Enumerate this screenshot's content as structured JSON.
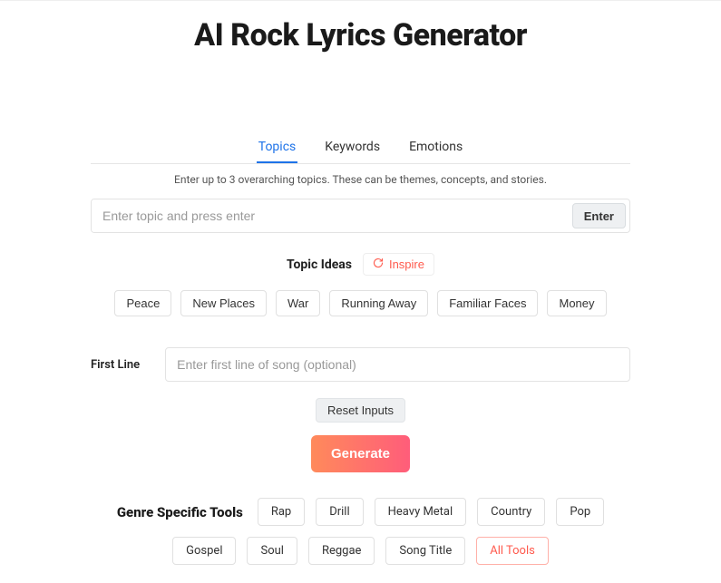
{
  "title": "AI Rock Lyrics Generator",
  "tabs": {
    "items": [
      "Topics",
      "Keywords",
      "Emotions"
    ],
    "active_index": 0
  },
  "hint": "Enter up to 3 overarching topics. These can be themes, concepts, and stories.",
  "topic_input": {
    "value": "",
    "placeholder": "Enter topic and press enter"
  },
  "enter_label": "Enter",
  "ideas": {
    "title": "Topic Ideas",
    "inspire_label": "Inspire",
    "chips": [
      "Peace",
      "New Places",
      "War",
      "Running Away",
      "Familiar Faces",
      "Money"
    ]
  },
  "firstline": {
    "label": "First Line",
    "value": "",
    "placeholder": "Enter first line of song (optional)"
  },
  "reset_label": "Reset Inputs",
  "generate_label": "Generate",
  "genre": {
    "title": "Genre Specific Tools",
    "chips": [
      "Rap",
      "Drill",
      "Heavy Metal",
      "Country",
      "Pop",
      "Gospel",
      "Soul",
      "Reggae",
      "Song Title",
      "All Tools"
    ],
    "accent_index": 9
  }
}
